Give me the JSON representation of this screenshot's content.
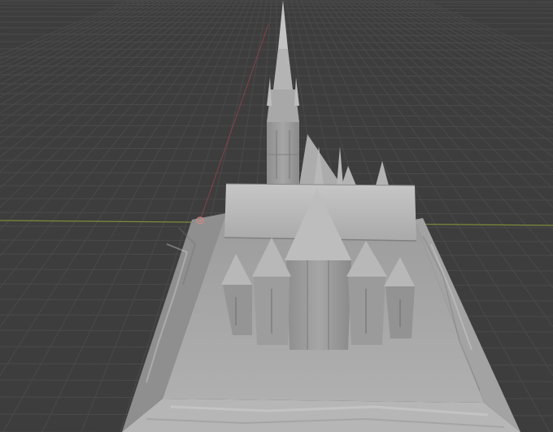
{
  "viewport": {
    "background_color": "#3d3d3d",
    "grid_color": "#4a4a4a",
    "x_axis_color": "#7d8a3a",
    "y_axis_color": "#8a3f4a",
    "model_base_color": "#a9a9a9",
    "model_wall_color": "#9a9a9a",
    "model_roof_color": "#b9b9b9",
    "model_shadow_color": "#7e7e7e",
    "origin_marker_color": "#d08a80"
  },
  "scene": {
    "object": "cathedral-model",
    "origin_marker": "object-origin-icon"
  }
}
